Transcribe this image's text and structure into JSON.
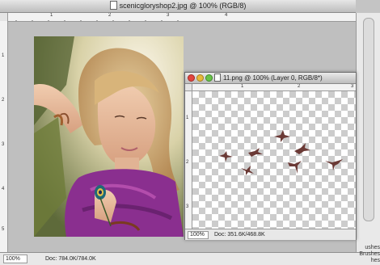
{
  "main_window": {
    "title": "scenicgloryshop2.jpg @ 100% (RGB/8)",
    "zoom": "100%",
    "doc_info": "Doc: 784.0K/784.0K",
    "ruler_numbers_top": [
      "1",
      "2",
      "3",
      "4"
    ],
    "ruler_numbers_left": [
      "1",
      "2",
      "3",
      "4",
      "5"
    ]
  },
  "image_window": {
    "title": "11.png @ 100% (Layer 0, RGB/8*)",
    "zoom": "100%",
    "doc_info": "Doc: 351.6K/468.8K",
    "ruler_numbers_top": [
      "1",
      "2",
      "3"
    ],
    "ruler_numbers_left": [
      "1",
      "2",
      "3"
    ]
  },
  "side_panel": {
    "label_1": "ushes",
    "label_2": "Brushes",
    "label_3": "hes"
  },
  "colors": {
    "bird": "#6b3a36",
    "scarf": "#8a2f8f"
  }
}
